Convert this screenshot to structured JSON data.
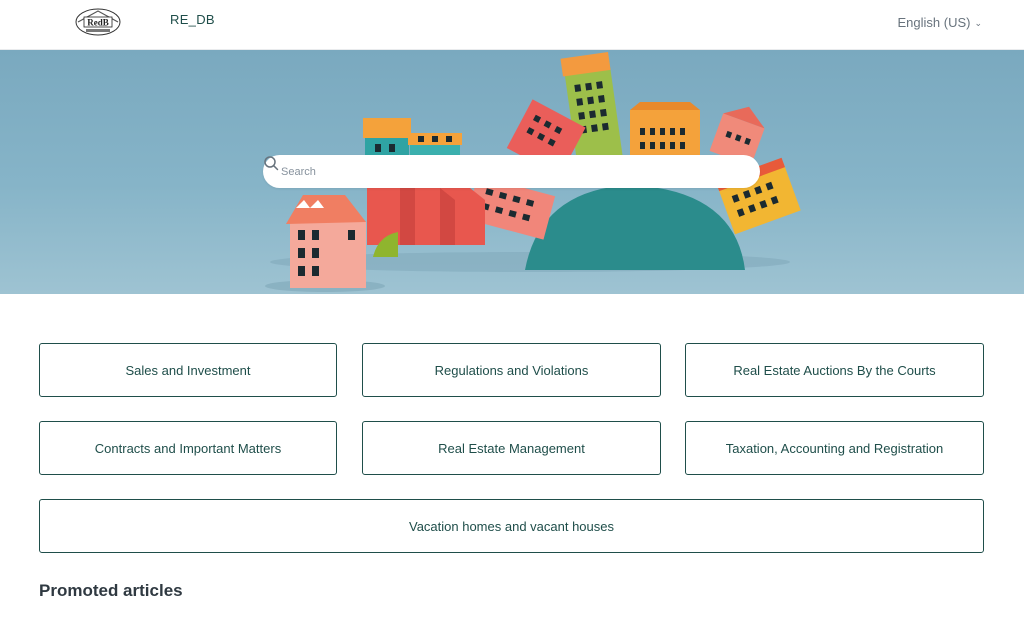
{
  "header": {
    "logo_text": "RedB",
    "brand": "RE_DB",
    "language": "English (US)",
    "language_icon": "chevron-down-icon"
  },
  "hero": {
    "search": {
      "placeholder": "Search",
      "value": "",
      "icon": "search-icon"
    }
  },
  "categories": [
    {
      "label": "Sales and Investment"
    },
    {
      "label": "Regulations and Violations"
    },
    {
      "label": "Real Estate Auctions By the Courts"
    },
    {
      "label": "Contracts and Important Matters"
    },
    {
      "label": "Real Estate Management"
    },
    {
      "label": "Taxation, Accounting and Registration"
    },
    {
      "label": "Vacation homes and vacant houses"
    }
  ],
  "sections": {
    "promoted_title": "Promoted articles"
  },
  "colors": {
    "brand": "#1f4e4a",
    "hero_bg": "#86b4c8",
    "text": "#2f3941"
  }
}
